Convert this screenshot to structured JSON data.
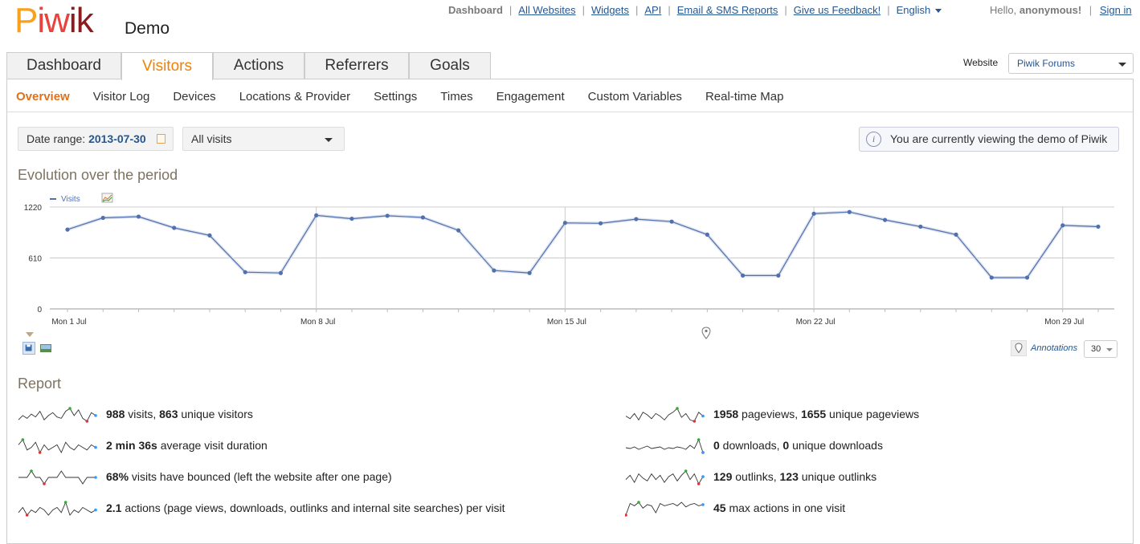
{
  "header": {
    "logo": {
      "p1": "P",
      "p2": "iw",
      "p3": "ik"
    },
    "site_name": "Demo",
    "nav": [
      "Dashboard",
      "All Websites",
      "Widgets",
      "API",
      "Email & SMS Reports",
      "Give us Feedback!"
    ],
    "language": "English",
    "hello_prefix": "Hello,",
    "user": "anonymous!",
    "signin": "Sign in"
  },
  "tabs": [
    "Dashboard",
    "Visitors",
    "Actions",
    "Referrers",
    "Goals"
  ],
  "active_tab": "Visitors",
  "website": {
    "label": "Website",
    "selected": "Piwik Forums"
  },
  "subnav": [
    "Overview",
    "Visitor Log",
    "Devices",
    "Locations & Provider",
    "Settings",
    "Times",
    "Engagement",
    "Custom Variables",
    "Real-time Map"
  ],
  "date": {
    "label": "Date range:",
    "value": "2013-07-30"
  },
  "segment": {
    "selected": "All visits"
  },
  "notice": "You are currently viewing the demo of Piwik",
  "evolution_title": "Evolution over the period",
  "annotations": {
    "label": "Annotations",
    "period": "30"
  },
  "chart_data": {
    "type": "line",
    "series": [
      {
        "name": "Visits",
        "values": [
          950,
          1090,
          1105,
          970,
          880,
          440,
          430,
          1120,
          1080,
          1115,
          1095,
          940,
          460,
          430,
          1030,
          1025,
          1075,
          1045,
          890,
          400,
          400,
          1140,
          1160,
          1065,
          985,
          890,
          375,
          375,
          1000,
          985
        ]
      }
    ],
    "x_tick_labels": [
      "Mon 1 Jul",
      "Mon 8 Jul",
      "Mon 15 Jul",
      "Mon 22 Jul",
      "Mon 29 Jul"
    ],
    "y_ticks": [
      0,
      610,
      1220
    ],
    "ylim": [
      0,
      1220
    ],
    "grid": true,
    "legend": "top-left",
    "color": "#5170ae"
  },
  "report": {
    "title": "Report",
    "left": [
      {
        "parts": [
          {
            "b": "988"
          },
          {
            "t": " visits, "
          },
          {
            "b": "863"
          },
          {
            "t": " unique visitors"
          }
        ],
        "spark": [
          6,
          9,
          7,
          10,
          8,
          12,
          6,
          9,
          11,
          8,
          7,
          12,
          14,
          9,
          13,
          7,
          5,
          11,
          9
        ]
      },
      {
        "parts": [
          {
            "b": "2 min 36s"
          },
          {
            "t": " average visit duration"
          }
        ],
        "spark": [
          12,
          14,
          10,
          11,
          13,
          9,
          12,
          10,
          11,
          12,
          9,
          13,
          11,
          10,
          12,
          11,
          10,
          12,
          11
        ]
      },
      {
        "parts": [
          {
            "b": "68%"
          },
          {
            "t": " visits have bounced (left the website after one page)"
          }
        ],
        "spark": [
          11,
          11,
          11,
          12,
          11,
          11,
          10,
          11,
          11,
          11,
          12,
          11,
          11,
          11,
          11,
          10,
          11,
          11,
          11
        ]
      },
      {
        "parts": [
          {
            "b": "2.1"
          },
          {
            "t": " actions (page views, downloads, outlinks and internal site searches) per visit"
          }
        ],
        "spark": [
          10,
          12,
          9,
          11,
          10,
          12,
          11,
          9,
          11,
          12,
          10,
          14,
          9,
          11,
          10,
          12,
          11,
          10,
          11
        ]
      }
    ],
    "right": [
      {
        "parts": [
          {
            "b": "1958"
          },
          {
            "t": " pageviews, "
          },
          {
            "b": "1655"
          },
          {
            "t": " unique pageviews"
          }
        ],
        "spark": [
          9,
          7,
          11,
          6,
          12,
          10,
          7,
          11,
          9,
          6,
          10,
          12,
          15,
          8,
          11,
          6,
          5,
          12,
          9
        ]
      },
      {
        "parts": [
          {
            "b": "0"
          },
          {
            "t": " downloads, "
          },
          {
            "b": "0"
          },
          {
            "t": " unique downloads"
          }
        ],
        "spark": [
          10,
          9,
          11,
          8,
          10,
          12,
          9,
          10,
          11,
          8,
          10,
          9,
          11,
          10,
          8,
          13,
          9,
          20,
          4
        ]
      },
      {
        "parts": [
          {
            "b": "129"
          },
          {
            "t": " outlinks, "
          },
          {
            "b": "123"
          },
          {
            "t": " unique outlinks"
          }
        ],
        "spark": [
          8,
          11,
          6,
          12,
          9,
          7,
          12,
          8,
          11,
          6,
          10,
          12,
          7,
          11,
          14,
          8,
          12,
          5,
          10
        ]
      },
      {
        "parts": [
          {
            "b": "45"
          },
          {
            "t": " max actions in one visit"
          }
        ],
        "spark": [
          4,
          14,
          12,
          15,
          10,
          13,
          12,
          6,
          14,
          12,
          13,
          14,
          12,
          15,
          11,
          13,
          14,
          12,
          13
        ]
      }
    ]
  }
}
